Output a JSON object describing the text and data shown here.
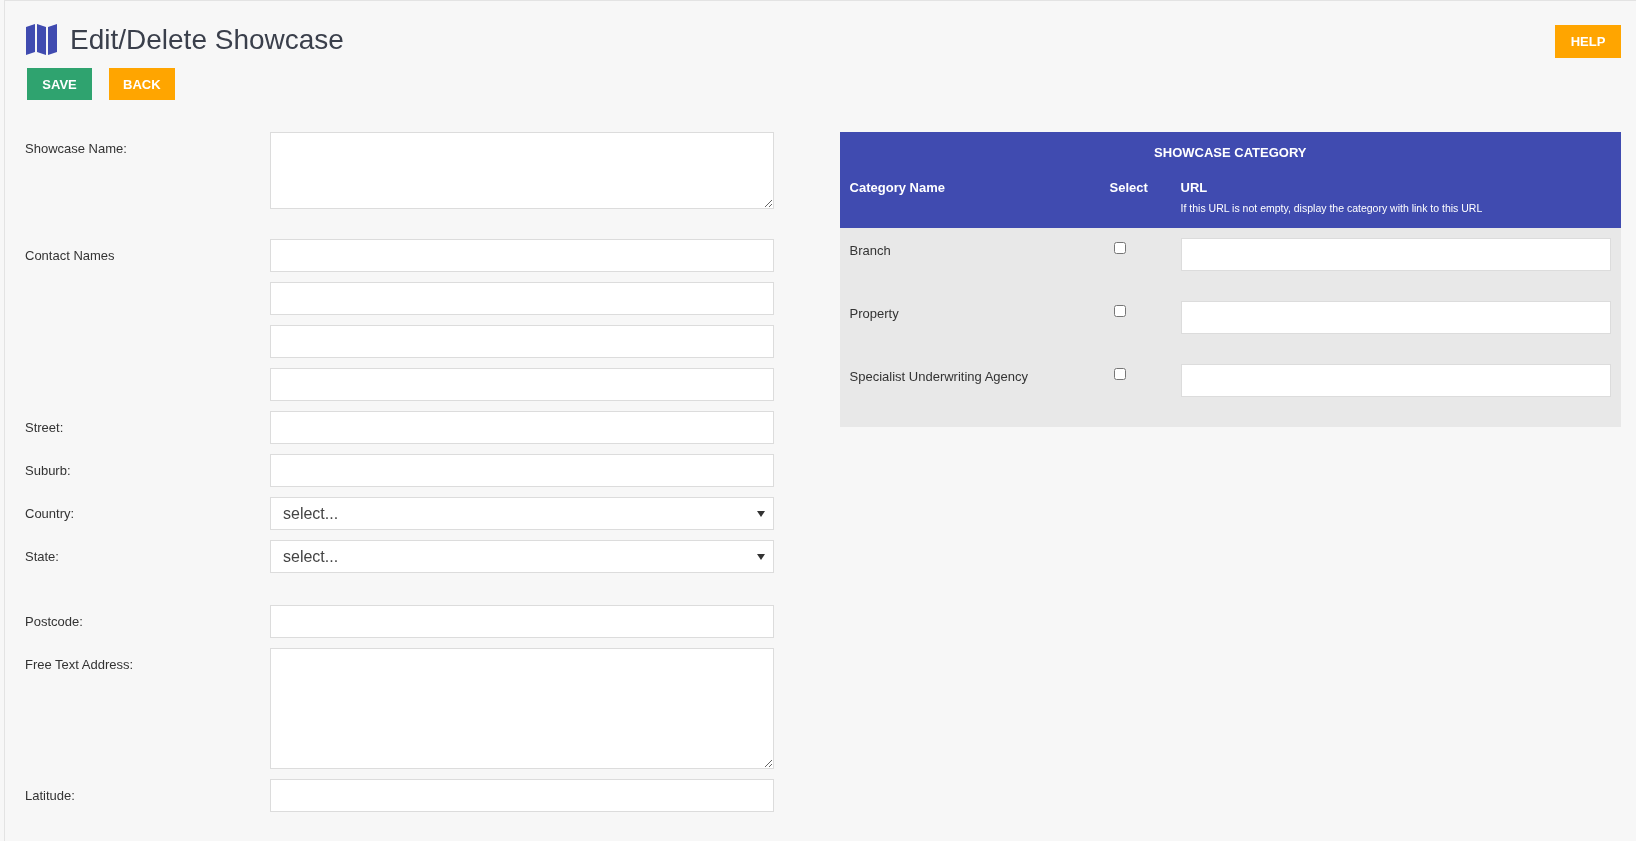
{
  "page": {
    "title": "Edit/Delete Showcase"
  },
  "buttons": [
    {
      "label": "SAVE",
      "kind": "primary"
    },
    {
      "label": "BACK",
      "kind": "secondary"
    }
  ],
  "help_button": {
    "label": "HELP"
  },
  "fields": [
    {
      "label": "Showcase Name:",
      "kind": "textarea"
    },
    {
      "label": "Contact Names",
      "kind": "text"
    },
    {
      "kind": "text"
    },
    {
      "kind": "text"
    },
    {
      "kind": "text"
    },
    {
      "label": "Street:",
      "kind": "text"
    },
    {
      "label": "Suburb:",
      "kind": "text"
    },
    {
      "label": "Country:",
      "kind": "select",
      "value": "select..."
    },
    {
      "label": "State:",
      "kind": "select",
      "value": "select..."
    },
    {
      "label": "Postcode:",
      "kind": "text"
    },
    {
      "label": "Free Text Address:",
      "kind": "textarea"
    },
    {
      "label": "Latitude:",
      "kind": "text"
    }
  ],
  "category_table": {
    "title": "SHOWCASE CATEGORY",
    "columns": [
      "Category Name",
      "Select",
      "URL"
    ],
    "url_hint": "If this URL is not empty, display the category with link to this URL",
    "rows": [
      {
        "name": "Branch",
        "checked": false
      },
      {
        "name": "Property",
        "checked": false
      },
      {
        "name": "Specialist Underwriting Agency",
        "checked": false
      }
    ]
  }
}
